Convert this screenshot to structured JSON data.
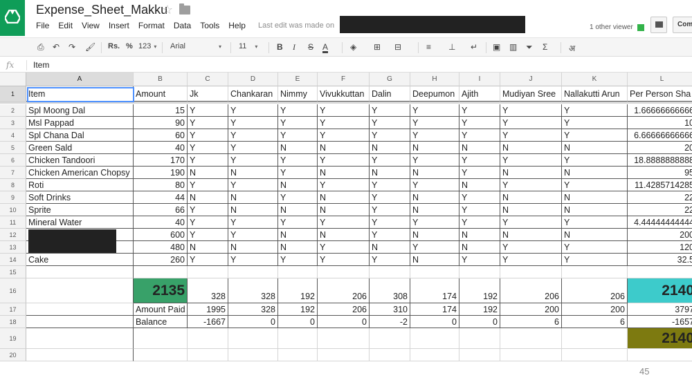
{
  "app": {
    "title": "Expense_Sheet_Makku",
    "menu": [
      "File",
      "Edit",
      "View",
      "Insert",
      "Format",
      "Data",
      "Tools",
      "Help"
    ],
    "last_edit": "Last edit was made on",
    "viewers": "1 other viewer",
    "comments_label": "Com"
  },
  "toolbar": {
    "currency": "Rs.",
    "percent": "%",
    "more_formats": "123",
    "font": "Arial",
    "font_size": "11",
    "bold": "B",
    "italic": "I",
    "strike": "S",
    "text_color": "A",
    "functions": "Σ",
    "input_tools": "अ"
  },
  "formula_bar": {
    "fx": "fx",
    "value": "Item"
  },
  "columns": [
    "A",
    "B",
    "C",
    "D",
    "E",
    "F",
    "G",
    "H",
    "I",
    "J",
    "K",
    "L"
  ],
  "rows": [
    "1",
    "2",
    "3",
    "4",
    "5",
    "6",
    "7",
    "8",
    "9",
    "10",
    "11",
    "12",
    "13",
    "14",
    "15",
    "16",
    "17",
    "18",
    "19",
    "20"
  ],
  "sheet": {
    "header": [
      "Item",
      "Amount",
      "Jk",
      "Chankaran",
      "Nimmy",
      "Vivukkuttan",
      "Dalin",
      "Deepumon",
      "Ajith",
      "Mudiyan Sree",
      "Nallakutti Arun",
      "Per Person Sha"
    ],
    "items": [
      [
        "Spl Moong Dal",
        "15",
        "Y",
        "Y",
        "Y",
        "Y",
        "Y",
        "Y",
        "Y",
        "Y",
        "Y",
        "1.66666666666"
      ],
      [
        "Msl Pappad",
        "90",
        "Y",
        "Y",
        "Y",
        "Y",
        "Y",
        "Y",
        "Y",
        "Y",
        "Y",
        "10"
      ],
      [
        "Spl Chana Dal",
        "60",
        "Y",
        "Y",
        "Y",
        "Y",
        "Y",
        "Y",
        "Y",
        "Y",
        "Y",
        "6.66666666666"
      ],
      [
        "Green Sald",
        "40",
        "Y",
        "Y",
        "N",
        "N",
        "N",
        "N",
        "N",
        "N",
        "N",
        "20"
      ],
      [
        "Chicken Tandoori",
        "170",
        "Y",
        "Y",
        "Y",
        "Y",
        "Y",
        "Y",
        "Y",
        "Y",
        "Y",
        "18.8888888888"
      ],
      [
        "Chicken American Chopsy",
        "190",
        "N",
        "N",
        "Y",
        "N",
        "N",
        "N",
        "Y",
        "N",
        "N",
        "95"
      ],
      [
        "Roti",
        "80",
        "Y",
        "Y",
        "N",
        "Y",
        "Y",
        "Y",
        "N",
        "Y",
        "Y",
        "11.4285714285"
      ],
      [
        "Soft Drinks",
        "44",
        "N",
        "N",
        "Y",
        "N",
        "Y",
        "N",
        "Y",
        "N",
        "N",
        "22"
      ],
      [
        "Sprite",
        "66",
        "Y",
        "N",
        "N",
        "N",
        "Y",
        "N",
        "Y",
        "N",
        "N",
        "22"
      ],
      [
        "Mineral Water",
        "40",
        "Y",
        "Y",
        "Y",
        "Y",
        "Y",
        "Y",
        "Y",
        "Y",
        "Y",
        "4.44444444444"
      ],
      [
        "",
        "600",
        "Y",
        "Y",
        "N",
        "N",
        "Y",
        "N",
        "N",
        "N",
        "N",
        "200"
      ],
      [
        "",
        "480",
        "N",
        "N",
        "N",
        "Y",
        "N",
        "Y",
        "N",
        "Y",
        "Y",
        "120"
      ],
      [
        "Cake",
        "260",
        "Y",
        "Y",
        "Y",
        "Y",
        "Y",
        "N",
        "Y",
        "Y",
        "Y",
        "32.5"
      ]
    ],
    "totals": [
      "",
      "2135",
      "328",
      "328",
      "192",
      "206",
      "308",
      "174",
      "192",
      "206",
      "206",
      "2140"
    ],
    "amount_paid": [
      "",
      "Amount Paid",
      "1995",
      "328",
      "192",
      "206",
      "310",
      "174",
      "192",
      "200",
      "200",
      "3797"
    ],
    "balance": [
      "",
      "Balance",
      "-1667",
      "0",
      "0",
      "0",
      "-2",
      "0",
      "0",
      "6",
      "6",
      "-1657"
    ],
    "grand_total": "2140"
  },
  "colors": {
    "total_amount_bg": "#38a169",
    "total_share_bg": "#3dcbcb",
    "grand_total_bg": "#7d7a10",
    "logo": "#0f9d58"
  },
  "page_number": "45"
}
